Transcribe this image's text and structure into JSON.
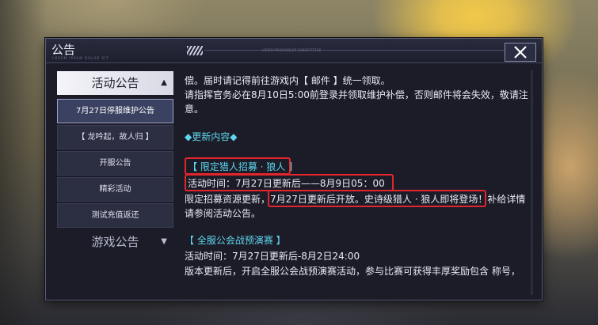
{
  "dialog": {
    "title": "公告",
    "deco_text": "LOREM IPSUM DOLOR SIT",
    "deco_text2": "LOREM IPSUM DOLOR CONSECTETUR",
    "close_icon": "close-icon"
  },
  "sidebar": {
    "category_active": "活动公告",
    "category_active_arrow": "▲",
    "category_other": "游戏公告",
    "category_other_arrow": "▼",
    "items": [
      {
        "label": "7月27日停服维护公告"
      },
      {
        "label": "【 龙吟起，故人归 】"
      },
      {
        "label": "开服公告"
      },
      {
        "label": "精彩活动"
      },
      {
        "label": "测试充值返还"
      }
    ]
  },
  "content": {
    "line1": "偿。届时请记得前往游戏内【 邮件 】统一领取。",
    "line2": "请指挥官务必在8月10日5:00前登录并领取维护补偿，否则邮件将会失效，敬请注",
    "line3": "意。",
    "update_header": "◆更新内容◆",
    "section1_title": "【 限定猎人招募 · 狼人 】",
    "section1_time": "活动时间：7月27日更新后——8月9日05：00",
    "section1_desc_a": "限定招募资源更新，",
    "section1_desc_b": "7月27日更新后开放。史诗级猎人 · 狼人即将登场！",
    "section1_desc_c": "补给详情",
    "section1_desc2": "请参阅活动公告。",
    "section2_title": "【 全服公会战预演赛 】",
    "section2_time": "活动时间：7月27日更新后-8月2日24:00",
    "section2_desc": "版本更新后，开启全服公会战预演赛活动，参与比赛可获得丰厚奖励包含 称号，"
  },
  "colors": {
    "accent_cyan": "#5fd5ee",
    "highlight_red": "#e3262d",
    "panel_bg": "#1b1c27"
  }
}
